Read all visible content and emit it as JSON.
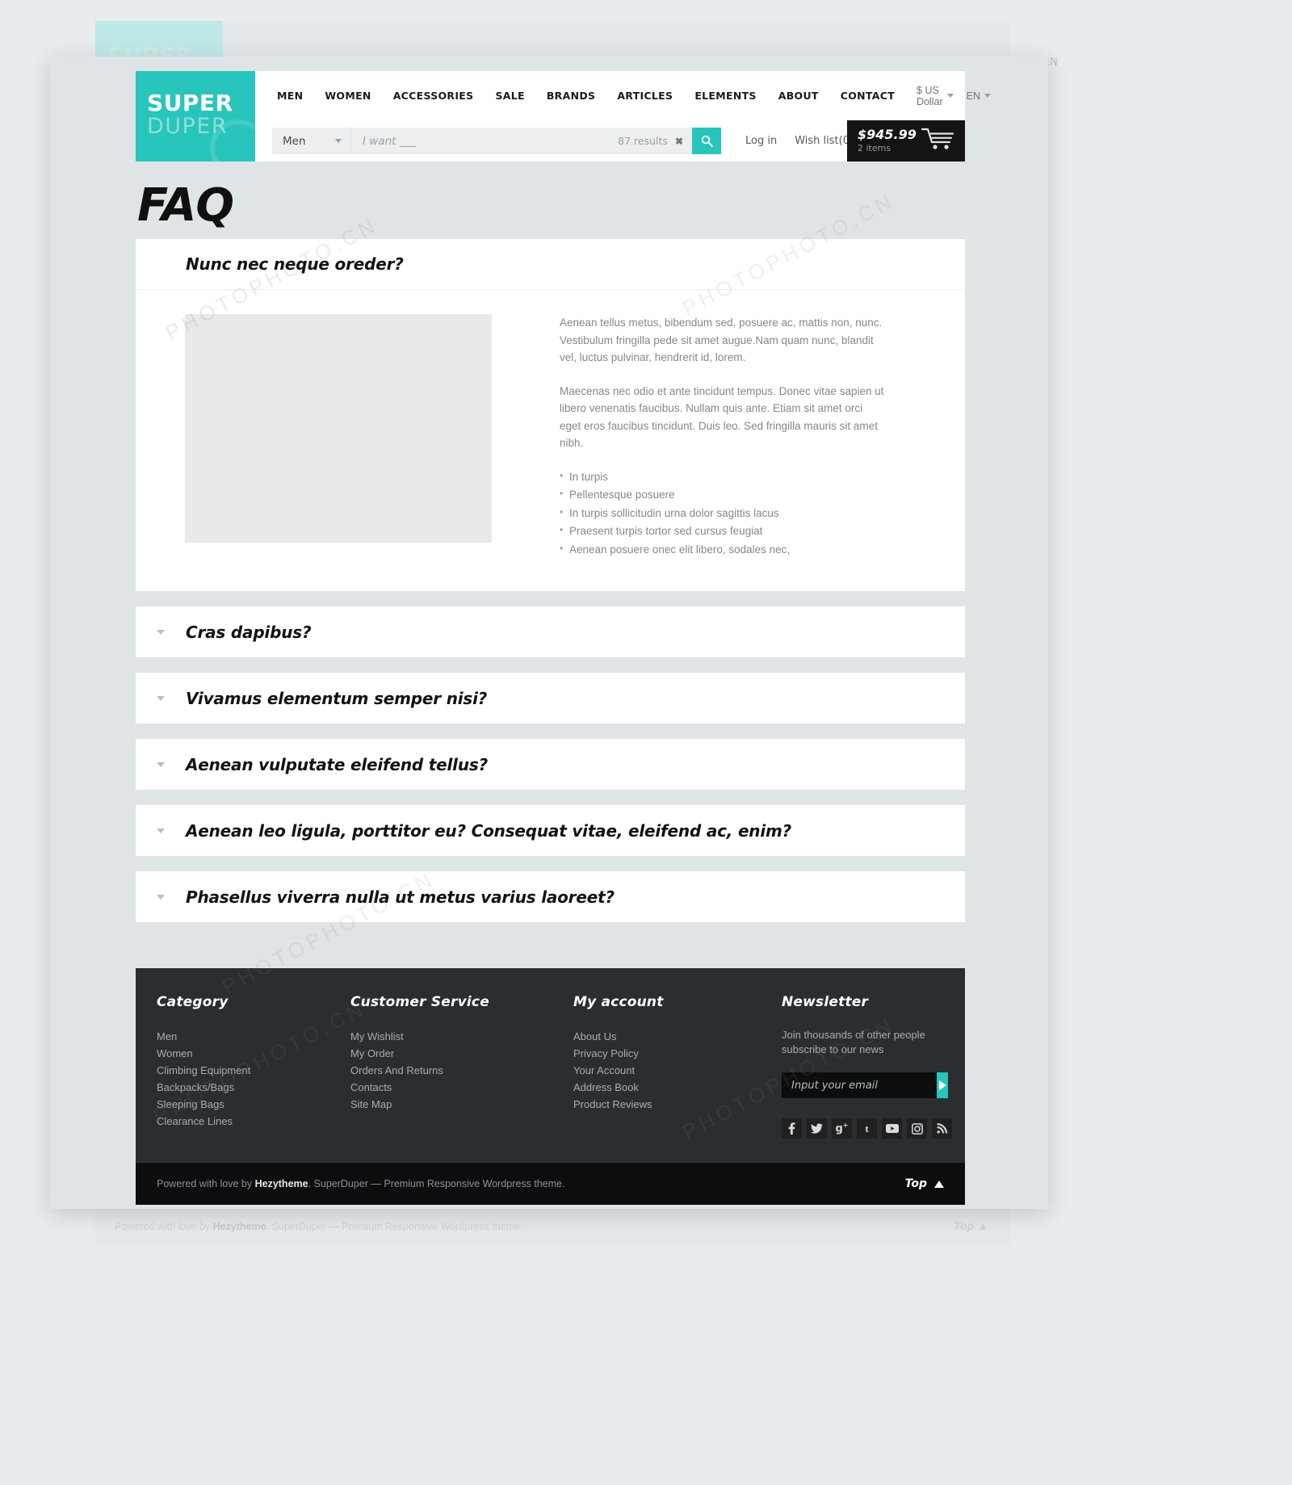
{
  "brand": {
    "logo_top": "SUPER",
    "logo_bottom": "DUPER",
    "accent_color": "#28c5bc"
  },
  "header": {
    "nav": [
      {
        "label": "MEN"
      },
      {
        "label": "WOMEN"
      },
      {
        "label": "ACCESSORIES"
      },
      {
        "label": "SALE"
      },
      {
        "label": "BRANDS"
      },
      {
        "label": "ARTICLES"
      },
      {
        "label": "ELEMENTS"
      },
      {
        "label": "ABOUT"
      },
      {
        "label": "CONTACT"
      }
    ],
    "currency": "$ US Dollar",
    "language": "EN"
  },
  "search": {
    "category": "Men",
    "placeholder": "I want ___",
    "results": "87 results",
    "clear": "✖"
  },
  "account": {
    "login": "Log in",
    "wishlist": "Wish list(0)"
  },
  "cart": {
    "price": "$945.99",
    "items": "2 items"
  },
  "page": {
    "title": "FAQ"
  },
  "faq": [
    {
      "question": "Nunc nec neque oreder?",
      "open": true,
      "paragraphs": [
        "Aenean tellus metus, bibendum sed, posuere ac, mattis non, nunc. Vestibulum fringilla pede sit amet augue.Nam quam nunc, blandit vel, luctus pulvinar, hendrerit id, lorem.",
        "Maecenas nec odio et ante tincidunt tempus. Donec vitae sapien ut libero venenatis faucibus. Nullam quis ante. Etiam sit amet orci eget eros faucibus tincidunt. Duis leo. Sed fringilla mauris sit amet nibh."
      ],
      "bullets": [
        "In turpis",
        "Pellentesque posuere",
        "In turpis sollicitudin urna dolor sagittis lacus",
        "Praesent turpis tortor sed cursus feugiat",
        "Aenean posuere onec elit libero, sodales nec,"
      ]
    },
    {
      "question": "Cras dapibus?",
      "open": false
    },
    {
      "question": "Vivamus elementum semper nisi?",
      "open": false
    },
    {
      "question": "Aenean vulputate eleifend tellus?",
      "open": false
    },
    {
      "question": "Aenean leo ligula, porttitor eu? Consequat vitae, eleifend ac, enim?",
      "open": false
    },
    {
      "question": "Phasellus viverra nulla ut metus varius laoreet?",
      "open": false
    }
  ],
  "footer": {
    "category": {
      "heading": "Category",
      "items": [
        "Men",
        "Women",
        "Climbing Equipment",
        "Backpacks/Bags",
        "Sleeping Bags",
        "Clearance Lines"
      ]
    },
    "customer_service": {
      "heading": "Customer Service",
      "items": [
        "My Wishlist",
        "My Order",
        "Orders And Returns",
        "Contacts",
        "Site Map"
      ]
    },
    "my_account": {
      "heading": "My account",
      "items": [
        "About Us",
        "Privacy Policy",
        "Your Account",
        "Address Book",
        "Product Reviews"
      ]
    },
    "newsletter": {
      "heading": "Newsletter",
      "blurb": "Join thousands of other people subscribe to our news",
      "placeholder": "Input your email"
    },
    "socials": [
      "facebook-icon",
      "twitter-icon",
      "google-plus-icon",
      "tumblr-icon",
      "youtube-icon",
      "instagram-icon",
      "rss-icon"
    ],
    "copyright_prefix": "Powered with love by ",
    "copyright_brand": "Hezytheme",
    "copyright_suffix": ". SuperDuper — Premium Responsive Wordpress theme.",
    "top_label": "Top"
  }
}
